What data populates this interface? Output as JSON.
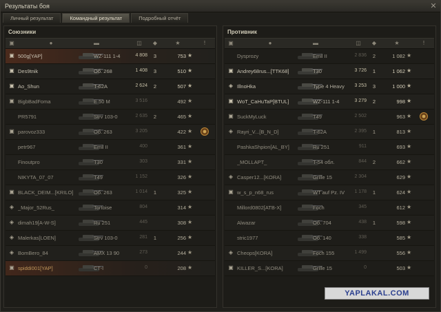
{
  "window": {
    "title": "Результаты боя",
    "close_icon": "close-icon"
  },
  "tabs": [
    {
      "label": "Личный результат"
    },
    {
      "label": "Командный результат"
    },
    {
      "label": "Подробный отчёт"
    }
  ],
  "active_tab": 1,
  "allies": {
    "title": "Союзники",
    "players": [
      {
        "platoon": "▣",
        "name": "500g[YAP]",
        "vehicle": "WZ-111 1-4",
        "damage": "4 808",
        "kills": "3",
        "xp": "753",
        "self": true,
        "alive": true,
        "dmg_hi": true,
        "medal": false
      },
      {
        "platoon": "▣",
        "name": "Des9tnik",
        "vehicle": "Об. 268",
        "damage": "1 408",
        "kills": "3",
        "xp": "510",
        "alive": true,
        "dmg_hi": true
      },
      {
        "platoon": "▣",
        "name": "Ao_Shun",
        "vehicle": "T-62A",
        "damage": "2 624",
        "kills": "2",
        "xp": "507",
        "alive": true,
        "dmg_hi": true
      },
      {
        "platoon": "▣",
        "name": "BigbBadFoma",
        "vehicle": "E 50 M",
        "damage": "3 516",
        "kills": "",
        "xp": "492"
      },
      {
        "platoon": "",
        "name": "PR5791",
        "vehicle": "Strv 103-0",
        "damage": "2 635",
        "kills": "2",
        "xp": "465"
      },
      {
        "platoon": "▣",
        "name": "parovoz333",
        "vehicle": "Об. 263",
        "damage": "3 205",
        "kills": "",
        "xp": "422",
        "medal": true
      },
      {
        "platoon": "",
        "name": "petr967",
        "vehicle": "Emil II",
        "damage": "400",
        "kills": "",
        "xp": "361"
      },
      {
        "platoon": "",
        "name": "Finoutpro",
        "vehicle": "T30",
        "damage": "303",
        "kills": "",
        "xp": "331"
      },
      {
        "platoon": "",
        "name": "NIKYTA_07_07",
        "vehicle": "T49",
        "damage": "1 152",
        "kills": "",
        "xp": "326"
      },
      {
        "platoon": "▣",
        "name": "BLACK_DEIM...[KRILO]",
        "vehicle": "Об. 263",
        "damage": "1 014",
        "kills": "1",
        "xp": "325"
      },
      {
        "platoon": "◈",
        "name": "_Major_52Rus_",
        "vehicle": "Tortoise",
        "damage": "804",
        "kills": "",
        "xp": "314"
      },
      {
        "platoon": "◈",
        "name": "dimah19[A-W-S]",
        "vehicle": "Ru 251",
        "damage": "445",
        "kills": "",
        "xp": "308"
      },
      {
        "platoon": "◈",
        "name": "Malerkas[LOEN]",
        "vehicle": "Strv 103-0",
        "damage": "281",
        "kills": "1",
        "xp": "256"
      },
      {
        "platoon": "◈",
        "name": "BomBero_84",
        "vehicle": "AMX 13 90",
        "damage": "273",
        "kills": "",
        "xp": "244"
      },
      {
        "platoon": "▣",
        "name": "spiddi001[YAP]",
        "vehicle": "CT-I",
        "damage": "0",
        "kills": "",
        "xp": "208",
        "self": true
      }
    ]
  },
  "enemies": {
    "title": "Противник",
    "players": [
      {
        "platoon": "",
        "name": "Dysprozy",
        "vehicle": "Emil II",
        "damage": "2 836",
        "kills": "2",
        "xp": "1 082"
      },
      {
        "platoon": "▣",
        "name": "Andrey68rus...[TTK68]",
        "vehicle": "T30",
        "damage": "3 726",
        "kills": "1",
        "xp": "1 062",
        "alive": true,
        "dmg_hi": true
      },
      {
        "platoon": "◈",
        "name": "IllnoHka",
        "vehicle": "Type 4 Heavy",
        "damage": "3 253",
        "kills": "3",
        "xp": "1 000",
        "alive": true,
        "dmg_hi": true
      },
      {
        "platoon": "▣",
        "name": "WoT_CaHuTaP[BTUL]",
        "vehicle": "WZ-111 1-4",
        "damage": "3 279",
        "kills": "2",
        "xp": "998",
        "alive": true,
        "dmg_hi": true
      },
      {
        "platoon": "▣",
        "name": "SuckMyLuck",
        "vehicle": "T49",
        "damage": "2 502",
        "kills": "",
        "xp": "963",
        "medal": true
      },
      {
        "platoon": "◈",
        "name": "Rayri_V...[B_N_D]",
        "vehicle": "T-62A",
        "damage": "2 395",
        "kills": "1",
        "xp": "813"
      },
      {
        "platoon": "",
        "name": "PashkaShpion[AL_BY]",
        "vehicle": "Ru 251",
        "damage": "911",
        "kills": "",
        "xp": "693"
      },
      {
        "platoon": "",
        "name": "_MOLLAPT_",
        "vehicle": "T-54 обл.",
        "damage": "844",
        "kills": "2",
        "xp": "662"
      },
      {
        "platoon": "◈",
        "name": "Casper12...[KORA]",
        "vehicle": "Grille 15",
        "damage": "2 304",
        "kills": "",
        "xp": "629"
      },
      {
        "platoon": "▣",
        "name": "w_s_p_n68_rus",
        "vehicle": "WT auf Pz. IV",
        "damage": "1 178",
        "kills": "1",
        "xp": "624"
      },
      {
        "platoon": "",
        "name": "Millord0802[ATB-X]",
        "vehicle": "Foch",
        "damage": "345",
        "kills": "",
        "xp": "612"
      },
      {
        "platoon": "",
        "name": "Alwazar",
        "vehicle": "Об. 704",
        "damage": "438",
        "kills": "1",
        "xp": "598"
      },
      {
        "platoon": "",
        "name": "stric1977",
        "vehicle": "Об. 140",
        "damage": "338",
        "kills": "",
        "xp": "585"
      },
      {
        "platoon": "◈",
        "name": "Cheops[KORA]",
        "vehicle": "Foch 155",
        "damage": "1 499",
        "kills": "",
        "xp": "556"
      },
      {
        "platoon": "▣",
        "name": "KILLER_S...[KORA]",
        "vehicle": "Grille 15",
        "damage": "0",
        "kills": "",
        "xp": "503"
      }
    ]
  },
  "watermark": "YAPLAKAL.COM"
}
